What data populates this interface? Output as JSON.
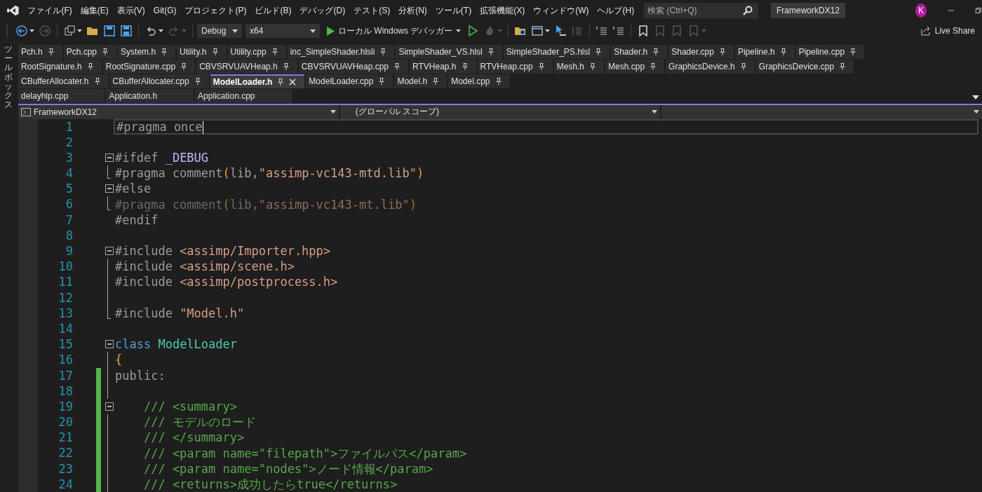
{
  "menu_bar": {
    "items": [
      "ファイル(F)",
      "編集(E)",
      "表示(V)",
      "Git(G)",
      "プロジェクト(P)",
      "ビルド(B)",
      "デバッグ(D)",
      "テスト(S)",
      "分析(N)",
      "ツール(T)",
      "拡張機能(X)",
      "ウィンドウ(W)",
      "ヘルプ(H)"
    ],
    "search": {
      "placeholder": "検索 (Ctrl+Q)"
    },
    "solution_name": "FrameworkDX12",
    "avatar": "K"
  },
  "toolbar": {
    "items": [
      {
        "kind": "back",
        "disabled": false,
        "menu": true
      },
      {
        "kind": "forward",
        "disabled": true,
        "menu": false
      },
      {
        "kind": "sep"
      },
      {
        "kind": "new-item",
        "disabled": false,
        "menu": true
      },
      {
        "kind": "open",
        "disabled": false,
        "menu": false
      },
      {
        "kind": "save",
        "disabled": false,
        "menu": false
      },
      {
        "kind": "save-all",
        "disabled": false,
        "menu": false
      },
      {
        "kind": "sep"
      },
      {
        "kind": "undo",
        "disabled": false,
        "menu": true
      },
      {
        "kind": "redo",
        "disabled": true,
        "menu": true
      },
      {
        "kind": "sep"
      },
      {
        "kind": "combo",
        "text": "Debug",
        "wide": false
      },
      {
        "kind": "combo",
        "text": "x64",
        "wide": true
      },
      {
        "kind": "run",
        "text": "ローカル Windows デバッガー",
        "menu": true
      },
      {
        "kind": "run-no-debug",
        "disabled": false,
        "menu": false
      },
      {
        "kind": "hot-reload",
        "disabled": true,
        "menu": true
      },
      {
        "kind": "sep"
      },
      {
        "kind": "browse",
        "disabled": false,
        "menu": false
      },
      {
        "kind": "window",
        "disabled": false,
        "menu": true
      },
      {
        "kind": "cursor",
        "disabled": false,
        "menu": false
      },
      {
        "kind": "columns",
        "disabled": true,
        "menu": false
      },
      {
        "kind": "sep"
      },
      {
        "kind": "comment",
        "disabled": false,
        "menu": false
      },
      {
        "kind": "uncomment",
        "disabled": false,
        "menu": false
      },
      {
        "kind": "sep"
      },
      {
        "kind": "bookmark",
        "disabled": false,
        "menu": false
      },
      {
        "kind": "bookmark",
        "disabled": true,
        "menu": false
      },
      {
        "kind": "bookmark",
        "disabled": true,
        "menu": false
      },
      {
        "kind": "bookmark",
        "disabled": true,
        "menu": true
      }
    ],
    "live_share": "Live Share"
  },
  "side_strip": {
    "label": "ツールボックス"
  },
  "tab_rows": [
    [
      {
        "label": "Pch.h",
        "pinned": true,
        "selected": false
      },
      {
        "label": "Pch.cpp",
        "pinned": true,
        "selected": false
      },
      {
        "label": "System.h",
        "pinned": true,
        "selected": false
      },
      {
        "label": "Utility.h",
        "pinned": true,
        "selected": false
      },
      {
        "label": "Utility.cpp",
        "pinned": true,
        "selected": false
      },
      {
        "label": "inc_SimpleShader.hlsli",
        "pinned": true,
        "selected": false
      },
      {
        "label": "SimpleShader_VS.hlsl",
        "pinned": true,
        "selected": false
      },
      {
        "label": "SimpleShader_PS.hlsl",
        "pinned": true,
        "selected": false
      },
      {
        "label": "Shader.h",
        "pinned": true,
        "selected": false
      },
      {
        "label": "Shader.cpp",
        "pinned": true,
        "selected": false
      },
      {
        "label": "Pipeline.h",
        "pinned": true,
        "selected": false
      },
      {
        "label": "Pipeline.cpp",
        "pinned": true,
        "selected": false
      }
    ],
    [
      {
        "label": "RootSignature.h",
        "pinned": true,
        "selected": false
      },
      {
        "label": "RootSignature.cpp",
        "pinned": true,
        "selected": false
      },
      {
        "label": "CBVSRVUAVHeap.h",
        "pinned": true,
        "selected": false
      },
      {
        "label": "CBVSRVUAVHeap.cpp",
        "pinned": true,
        "selected": false
      },
      {
        "label": "RTVHeap.h",
        "pinned": true,
        "selected": false
      },
      {
        "label": "RTVHeap.cpp",
        "pinned": true,
        "selected": false
      },
      {
        "label": "Mesh.h",
        "pinned": true,
        "selected": false
      },
      {
        "label": "Mesh.cpp",
        "pinned": true,
        "selected": false
      },
      {
        "label": "GraphicsDevice.h",
        "pinned": true,
        "selected": false
      },
      {
        "label": "GraphicsDevice.cpp",
        "pinned": true,
        "selected": false
      }
    ],
    [
      {
        "label": "CBufferAllocater.h",
        "pinned": true,
        "selected": false
      },
      {
        "label": "CBufferAllocater.cpp",
        "pinned": true,
        "selected": false
      },
      {
        "label": "ModelLoader.h",
        "pinned": true,
        "selected": true
      },
      {
        "label": "ModelLoader.cpp",
        "pinned": true,
        "selected": false
      },
      {
        "label": "Model.h",
        "pinned": true,
        "selected": false
      },
      {
        "label": "Model.cpp",
        "pinned": true,
        "selected": false
      }
    ],
    [
      {
        "label": "delayhlp.cpp",
        "pinned": false,
        "selected": false
      },
      {
        "label": "Application.h",
        "pinned": false,
        "selected": false
      },
      {
        "label": "Application.cpp",
        "pinned": false,
        "selected": false
      }
    ]
  ],
  "navigation_bar": {
    "project": "FrameworkDX12",
    "scope": "(グローバル スコープ)"
  },
  "editor": {
    "lines": [
      {
        "number": "1",
        "selected": true,
        "changed": false,
        "fold": false,
        "guide": false,
        "guide_end": false,
        "tokens": [
          {
            "text": "#pragma once",
            "kind": "directive"
          }
        ]
      },
      {
        "number": "2",
        "selected": false,
        "changed": false,
        "fold": false,
        "guide": false,
        "guide_end": false
      },
      {
        "number": "3",
        "selected": false,
        "changed": false,
        "fold": true,
        "guide": false,
        "guide_end": false,
        "tokens": [
          {
            "text": "#ifdef ",
            "kind": "directive"
          },
          {
            "text": "_DEBUG",
            "kind": "macro"
          }
        ]
      },
      {
        "number": "4",
        "selected": false,
        "changed": false,
        "fold": false,
        "guide": true,
        "guide_end": true,
        "tokens": [
          {
            "text": "#pragma comment",
            "kind": "directive"
          },
          {
            "text": "(",
            "kind": "paren"
          },
          {
            "text": "lib,",
            "kind": "directive"
          },
          {
            "text": "\"assimp-vc143-mtd.lib\"",
            "kind": "string"
          },
          {
            "text": ")",
            "kind": "paren"
          }
        ]
      },
      {
        "number": "5",
        "selected": false,
        "changed": false,
        "fold": true,
        "guide": false,
        "guide_end": false,
        "tokens": [
          {
            "text": "#else",
            "kind": "directive"
          }
        ]
      },
      {
        "number": "6",
        "selected": false,
        "changed": false,
        "fold": false,
        "guide": true,
        "guide_end": true,
        "inactive": true,
        "tokens": [
          {
            "text": "#pragma comment",
            "kind": "directive"
          },
          {
            "text": "(",
            "kind": "paren"
          },
          {
            "text": "lib,",
            "kind": "directive"
          },
          {
            "text": "\"assimp-vc143-mt.lib\"",
            "kind": "string"
          },
          {
            "text": ")",
            "kind": "paren"
          }
        ]
      },
      {
        "number": "7",
        "selected": false,
        "changed": false,
        "fold": false,
        "guide": false,
        "guide_end": false,
        "tokens": [
          {
            "text": "#endif",
            "kind": "directive"
          }
        ]
      },
      {
        "number": "8",
        "selected": false,
        "changed": false,
        "fold": false,
        "guide": false,
        "guide_end": false
      },
      {
        "number": "9",
        "selected": false,
        "changed": false,
        "fold": true,
        "guide": false,
        "guide_end": false,
        "tokens": [
          {
            "text": "#include ",
            "kind": "directive"
          },
          {
            "text": "<assimp/Importer.hpp>",
            "kind": "string"
          }
        ]
      },
      {
        "number": "10",
        "selected": false,
        "changed": false,
        "fold": false,
        "guide": true,
        "guide_end": false,
        "tokens": [
          {
            "text": "#include ",
            "kind": "directive"
          },
          {
            "text": "<assimp/scene.h>",
            "kind": "string"
          }
        ]
      },
      {
        "number": "11",
        "selected": false,
        "changed": false,
        "fold": false,
        "guide": true,
        "guide_end": false,
        "tokens": [
          {
            "text": "#include ",
            "kind": "directive"
          },
          {
            "text": "<assimp/postprocess.h>",
            "kind": "string"
          }
        ]
      },
      {
        "number": "12",
        "selected": false,
        "changed": false,
        "fold": false,
        "guide": true,
        "guide_end": false
      },
      {
        "number": "13",
        "selected": false,
        "changed": false,
        "fold": false,
        "guide": true,
        "guide_end": true,
        "tokens": [
          {
            "text": "#include ",
            "kind": "directive"
          },
          {
            "text": "\"Model.h\"",
            "kind": "string"
          }
        ]
      },
      {
        "number": "14",
        "selected": false,
        "changed": false,
        "fold": false,
        "guide": false,
        "guide_end": false
      },
      {
        "number": "15",
        "selected": false,
        "changed": false,
        "fold": true,
        "guide": false,
        "guide_end": false,
        "tokens": [
          {
            "text": "class ",
            "kind": "keyword"
          },
          {
            "text": "ModelLoader",
            "kind": "type"
          }
        ]
      },
      {
        "number": "16",
        "selected": false,
        "changed": false,
        "fold": false,
        "guide": true,
        "guide_end": false,
        "tokens": [
          {
            "text": "{",
            "kind": "brace"
          }
        ]
      },
      {
        "number": "17",
        "selected": false,
        "changed": true,
        "fold": false,
        "guide": true,
        "guide_end": false,
        "tokens": [
          {
            "text": "public:",
            "kind": "directive"
          }
        ]
      },
      {
        "number": "18",
        "selected": false,
        "changed": true,
        "fold": false,
        "guide": true,
        "guide_end": false
      },
      {
        "number": "19",
        "selected": false,
        "changed": true,
        "fold": true,
        "guide": false,
        "guide_end": false,
        "tokens": [
          {
            "text": "    /// <summary>",
            "kind": "comment"
          }
        ]
      },
      {
        "number": "20",
        "selected": false,
        "changed": true,
        "fold": false,
        "guide": true,
        "guide_end": false,
        "tokens": [
          {
            "text": "    /// モデルのロード",
            "kind": "comment"
          }
        ]
      },
      {
        "number": "21",
        "selected": false,
        "changed": true,
        "fold": false,
        "guide": true,
        "guide_end": false,
        "tokens": [
          {
            "text": "    /// </summary>",
            "kind": "comment"
          }
        ]
      },
      {
        "number": "22",
        "selected": false,
        "changed": true,
        "fold": false,
        "guide": true,
        "guide_end": false,
        "tokens": [
          {
            "text": "    /// <param name=\"filepath\">ファイルパス</param>",
            "kind": "comment"
          }
        ]
      },
      {
        "number": "23",
        "selected": false,
        "changed": true,
        "fold": false,
        "guide": true,
        "guide_end": false,
        "tokens": [
          {
            "text": "    /// <param name=\"nodes\">ノード情報</param>",
            "kind": "comment"
          }
        ]
      },
      {
        "number": "24",
        "selected": false,
        "changed": true,
        "fold": false,
        "guide": true,
        "guide_end": false,
        "tokens": [
          {
            "text": "    /// <returns>成功したらtrue</returns>",
            "kind": "comment"
          }
        ]
      }
    ]
  }
}
